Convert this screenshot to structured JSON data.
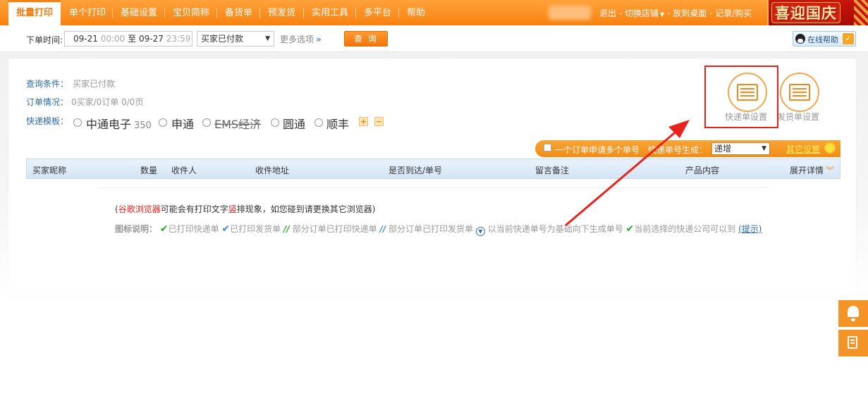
{
  "nav": {
    "items": [
      "批量打印",
      "单个打印",
      "基础设置",
      "宝贝简称",
      "备货单",
      "预发货",
      "实用工具",
      "多平台",
      "帮助"
    ],
    "right_links": {
      "logout": "退出",
      "switch_store": "切换店铺",
      "desktop": "放到桌面",
      "records": "记录/购买"
    },
    "banner_text": "喜迎国庆"
  },
  "search": {
    "label_time": "下单时间:",
    "date_from": "09-21",
    "time_from": "00:00",
    "to_text": "至",
    "date_to": "09-27",
    "time_to": "23:59",
    "status_selected": "买家已付款",
    "more_options": "更多选项",
    "query_button": "查 询",
    "online_help": "在线帮助"
  },
  "info": {
    "query_label": "查询条件：",
    "query_value": "买家已付款",
    "orders_label": "订单情况：",
    "orders_value": "0买家/0订单   0/0页",
    "template_label": "快递模板："
  },
  "templates": [
    {
      "name": "中通电子",
      "count": "350",
      "strike": false
    },
    {
      "name": "申通",
      "count": "",
      "strike": false
    },
    {
      "name": "EMS经济",
      "count": "",
      "strike": true
    },
    {
      "name": "圆通",
      "count": "",
      "strike": false
    },
    {
      "name": "顺丰",
      "count": "",
      "strike": false
    }
  ],
  "mini_buttons": {
    "add": "+",
    "remove": "−"
  },
  "settings_icons": {
    "express_label": "快递单设置",
    "invoice_label": "发货单设置"
  },
  "options_bar": {
    "multi_label": "一个订单申请多个单号",
    "gen_label": "快递单号生成：",
    "gen_selected": "递增",
    "other_settings": "其它设置"
  },
  "table": {
    "headers": [
      "买家昵称",
      "数量",
      "收件人",
      "收件地址",
      "是否到达/单号",
      "留言备注",
      "产品内容",
      "展开详情"
    ]
  },
  "notes": {
    "browser_open": "(",
    "browser_name": "谷歌浏览器",
    "browser_mid": "可能会有打印文字",
    "browser_word": "竖",
    "browser_end": "排现象，如您碰到请更换其它浏览器)"
  },
  "legend": {
    "title": "图标说明：",
    "item1": "已打印快递单",
    "item2": "已打印发货单",
    "item3": "部分订单已打印快递单",
    "item4": "部分订单已打印发货单",
    "item5": "以当前快递单号为基础向下生成单号",
    "item6": "当前选择的快递公司可以到",
    "tip": "(提示)"
  },
  "colors": {
    "brand_orange": "#f7810f",
    "link_blue": "#2e6aa8",
    "highlight_red": "#e8231b"
  }
}
